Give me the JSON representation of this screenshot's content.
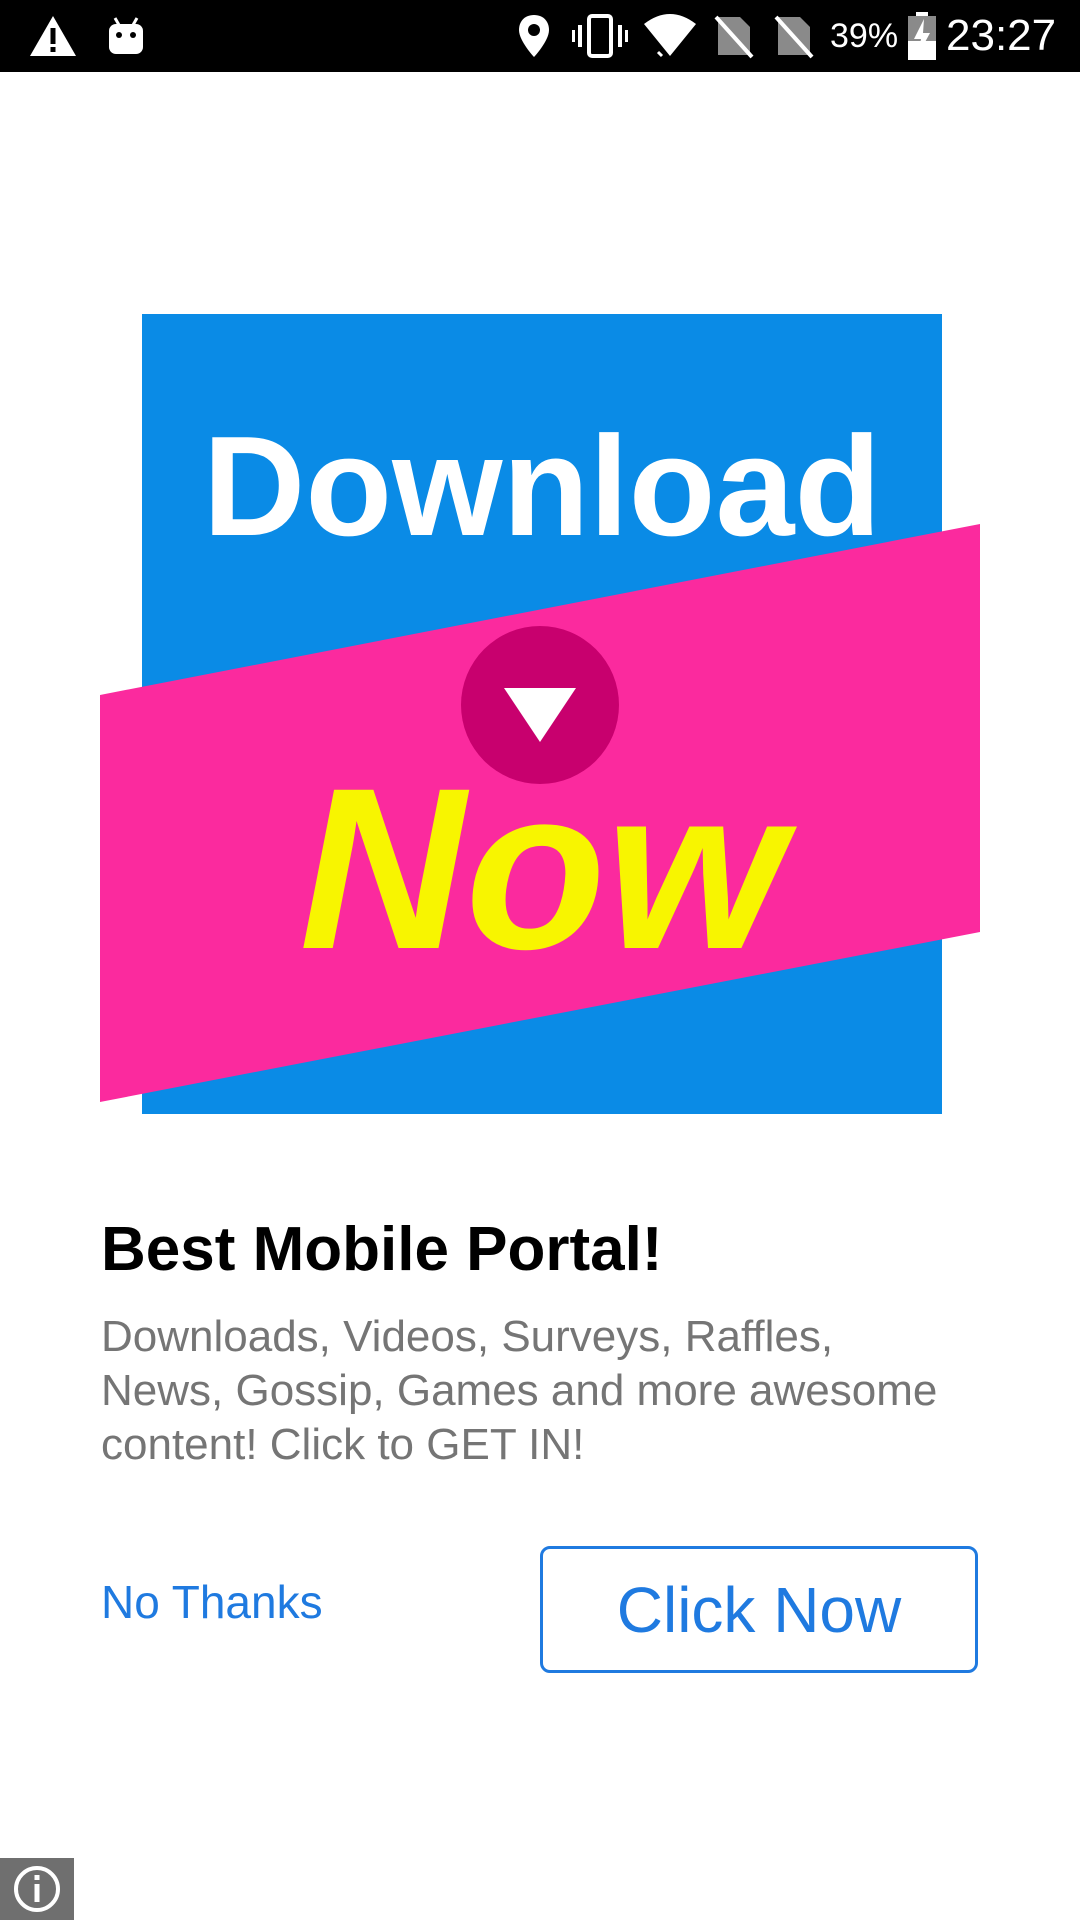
{
  "status_bar": {
    "battery_percent": "39%",
    "time": "23:27",
    "icons": [
      "warning-icon",
      "android-icon",
      "location-icon",
      "vibrate-icon",
      "wifi-icon",
      "no-sim-icon",
      "no-sim-icon",
      "battery-charging-icon"
    ]
  },
  "ad": {
    "image": {
      "top_text": "Download",
      "bottom_text": "Now",
      "colors": {
        "background": "#0a8be6",
        "band": "#fb2a9e",
        "circle": "#c8006e",
        "top_text": "#ffffff",
        "bottom_text": "#f8f500"
      }
    },
    "headline": "Best Mobile Portal!",
    "description": "Downloads, Videos, Surveys, Raffles, News, Gossip, Games and more awesome content! Click to GET IN!",
    "dismiss_label": "No Thanks",
    "cta_label": "Click Now",
    "accent_color": "#1f7ae0"
  },
  "info_icon": "info-icon"
}
